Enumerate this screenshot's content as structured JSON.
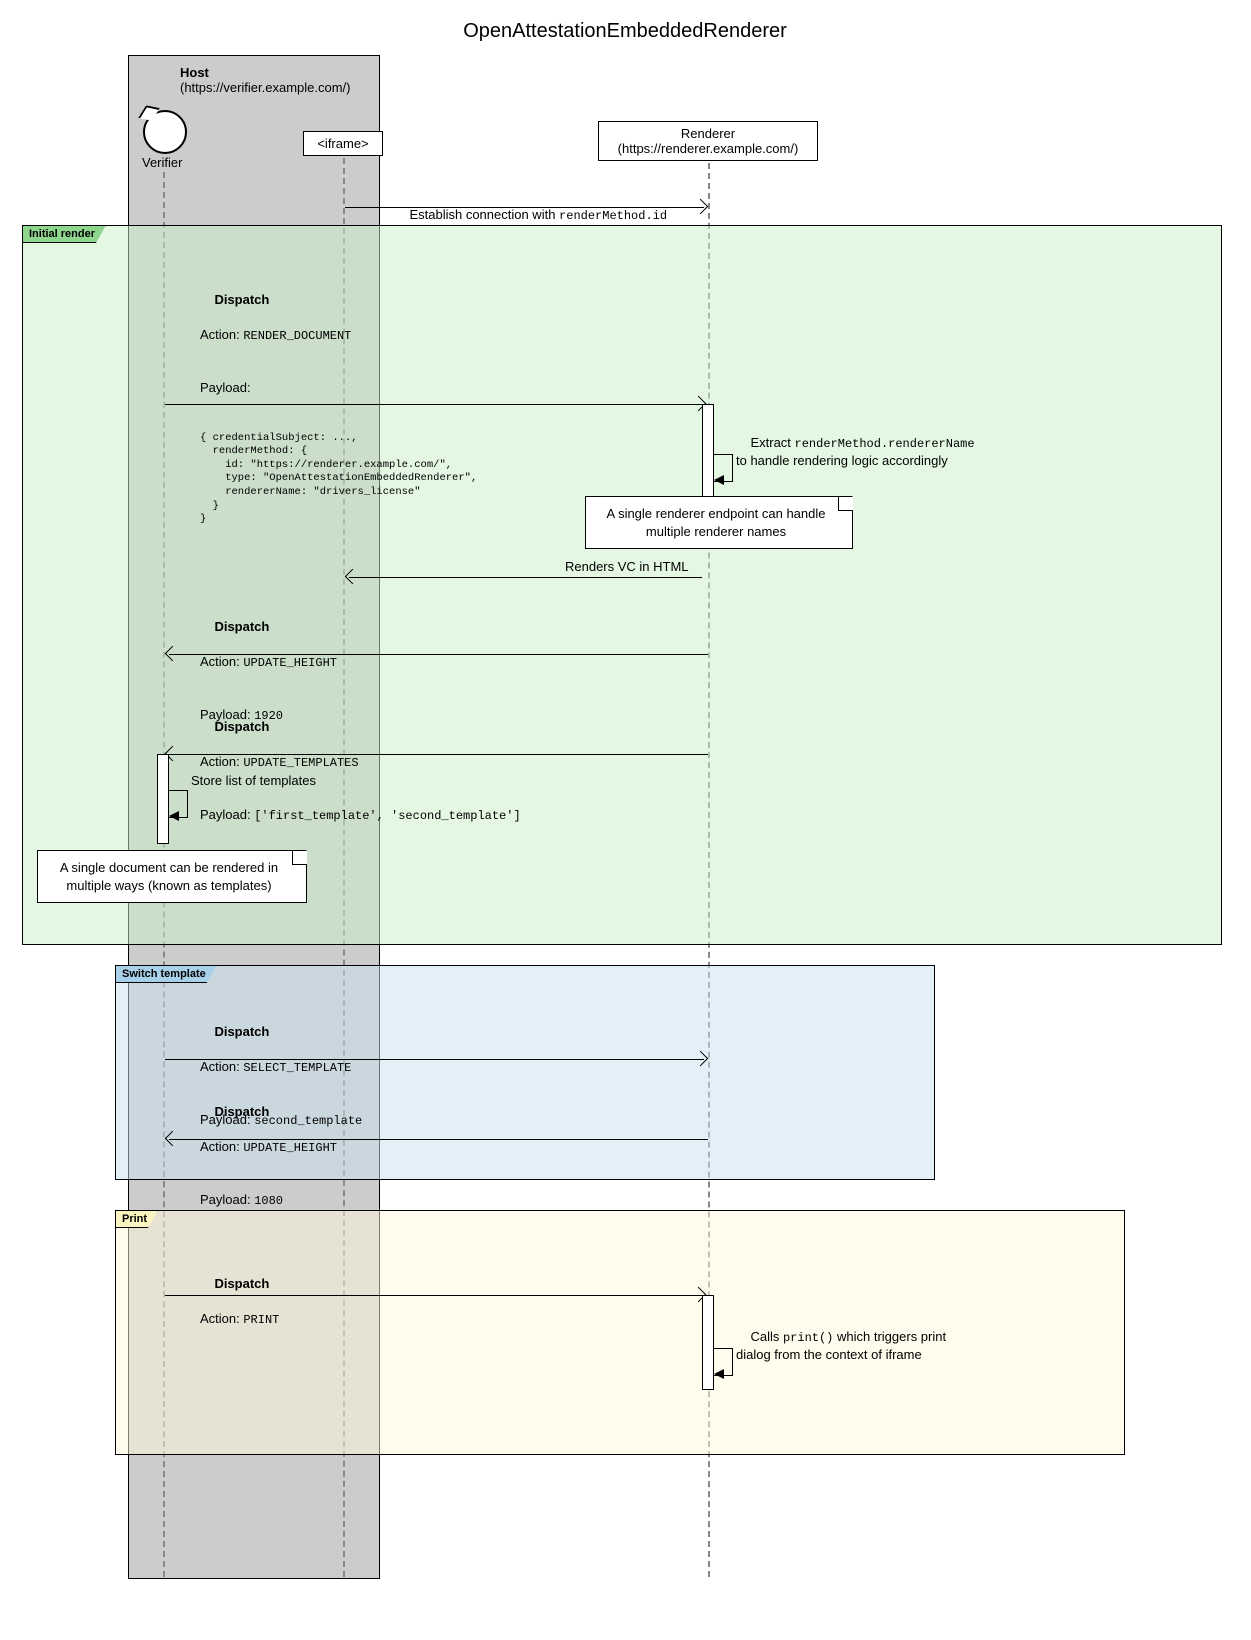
{
  "title": "OpenAttestationEmbeddedRenderer",
  "host": {
    "name": "Host",
    "url": "(https://verifier.example.com/)"
  },
  "actor": {
    "label": "Verifier"
  },
  "iframe_label": "<iframe>",
  "renderer": {
    "name": "Renderer",
    "url": "(https://renderer.example.com/)"
  },
  "msg_establish_pre": "Establish connection with ",
  "msg_establish_code": "renderMethod.id",
  "frame1_tag": "Initial render",
  "frame2_tag": "Switch template",
  "frame3_tag": "Print",
  "dispatch_label": "Dispatch",
  "action_label": "Action: ",
  "payload_label": "Payload: ",
  "payload_label_colon": "Payload:",
  "action_render_document": "RENDER_DOCUMENT",
  "render_payload": "{ credentialSubject: ...,\n  renderMethod: {\n    id: \"https://renderer.example.com/\",\n    type: \"OpenAttestationEmbeddedRenderer\",\n    rendererName: \"drivers_license\"\n  }\n}",
  "self1_pre": "Extract ",
  "self1_code": "renderMethod.rendererName",
  "self1_post": "\nto handle rendering logic accordingly",
  "note_renderer": "A single renderer endpoint can handle\nmultiple renderer names",
  "msg_renders_vc": "Renders VC in HTML",
  "action_update_height": "UPDATE_HEIGHT",
  "payload_1920": "1920",
  "action_update_templates": "UPDATE_TEMPLATES",
  "payload_templates": "['first_template', 'second_template']",
  "self2_text": "Store list of templates",
  "note_document": "A single document can be rendered in\nmultiple ways (known as templates)",
  "action_select_template": "SELECT_TEMPLATE",
  "payload_second_template": "second_template",
  "payload_1080": "1080",
  "action_print": "PRINT",
  "self3_pre": "Calls ",
  "self3_code": "print()",
  "self3_post": " which triggers print\ndialog from the context of iframe"
}
